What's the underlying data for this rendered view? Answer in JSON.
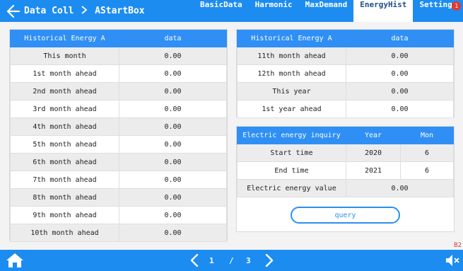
{
  "header": {
    "title": "Data Coll",
    "device": "AStartBox",
    "tabs": [
      {
        "label": "BasicData",
        "active": false
      },
      {
        "label": "Harmonic",
        "active": false
      },
      {
        "label": "MaxDemand",
        "active": false
      },
      {
        "label": "EnergyHist",
        "active": true
      },
      {
        "label": "Settings",
        "active": false
      }
    ],
    "notification_count": "1"
  },
  "left_table": {
    "headers": [
      "Historical Energy A",
      "data"
    ],
    "rows": [
      {
        "label": "This month",
        "value": "0.00"
      },
      {
        "label": "1st month ahead",
        "value": "0.00"
      },
      {
        "label": "2nd month ahead",
        "value": "0.00"
      },
      {
        "label": "3rd month ahead",
        "value": "0.00"
      },
      {
        "label": "4th month ahead",
        "value": "0.00"
      },
      {
        "label": "5th month ahead",
        "value": "0.00"
      },
      {
        "label": "6th month ahead",
        "value": "0.00"
      },
      {
        "label": "7th month ahead",
        "value": "0.00"
      },
      {
        "label": "8th month ahead",
        "value": "0.00"
      },
      {
        "label": "9th month ahead",
        "value": "0.00"
      },
      {
        "label": "10th month ahead",
        "value": "0.00"
      }
    ]
  },
  "right_table": {
    "headers": [
      "Historical Energy A",
      "data"
    ],
    "rows": [
      {
        "label": "11th month ahead",
        "value": "0.00"
      },
      {
        "label": "12th month ahead",
        "value": "0.00"
      },
      {
        "label": "This year",
        "value": "0.00"
      },
      {
        "label": "1st year ahead",
        "value": "0.00"
      }
    ]
  },
  "inquiry": {
    "headers": [
      "Electric energy inquiry",
      "Year",
      "Mon"
    ],
    "start_label": "Start time",
    "start_year": "2020",
    "start_month": "6",
    "end_label": "End time",
    "end_year": "2021",
    "end_month": "6",
    "value_label": "Electric energy value",
    "value": "0.00",
    "query_label": "query"
  },
  "pagination": {
    "current": "1",
    "separator": "/",
    "total": "3"
  },
  "corner_code": "B2",
  "colors": {
    "primary": "#1c8cf0",
    "header_row": "#2f8ff5",
    "badge": "#e23a2d",
    "corner_text": "#d23b2e"
  },
  "icons": [
    "back-arrow-icon",
    "chevron-right-icon",
    "home-icon",
    "prev-page-icon",
    "next-page-icon",
    "speaker-mute-icon"
  ]
}
